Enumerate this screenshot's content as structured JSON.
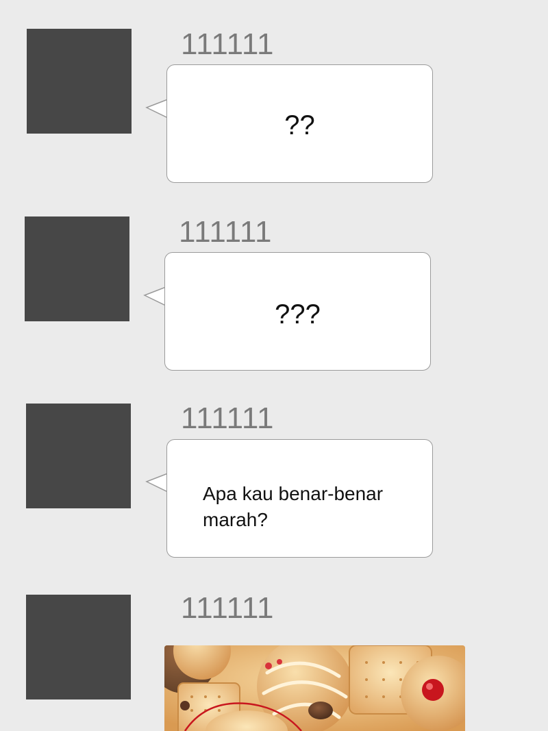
{
  "messages": [
    {
      "sender": "111111",
      "text": "??"
    },
    {
      "sender": "111111",
      "text": "???"
    },
    {
      "sender": "111111",
      "text": "Apa kau benar-benar marah?"
    },
    {
      "sender": "111111",
      "image": "cookie-biscuit-image"
    }
  ],
  "colors": {
    "background": "#ebebeb",
    "avatar": "#474747",
    "sender": "#7a7a7a",
    "bubble": "#ffffff",
    "bubble_border": "#9a9a9a",
    "text": "#111111"
  }
}
